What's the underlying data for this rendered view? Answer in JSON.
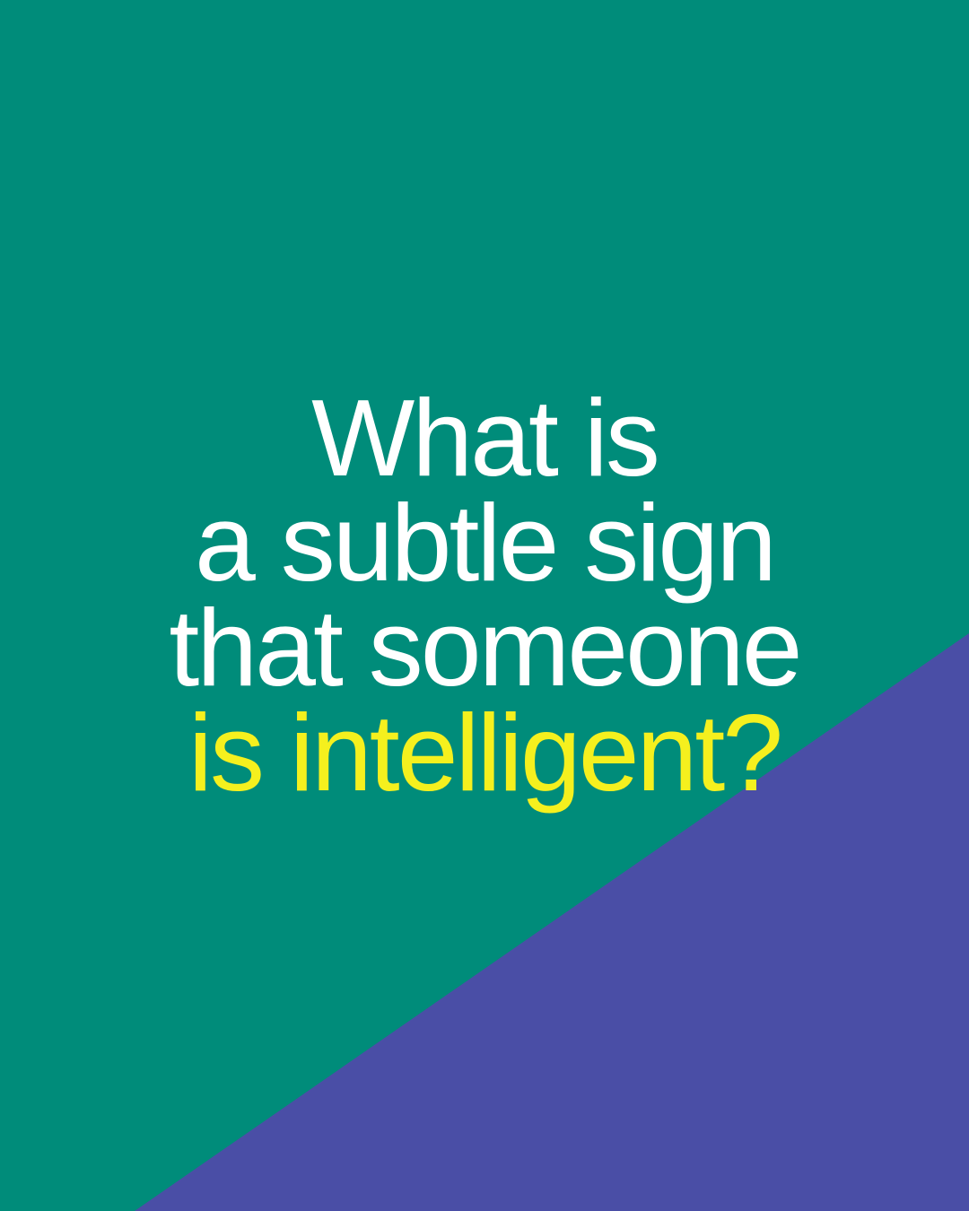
{
  "colors": {
    "background_top": "#008C7A",
    "background_bottom": "#4A4EA6",
    "text_primary": "#FFFFFF",
    "text_highlight": "#F5F01E"
  },
  "headline": {
    "lines": [
      "What is",
      "a subtle sign",
      "that someone",
      "is intelligent?"
    ]
  }
}
